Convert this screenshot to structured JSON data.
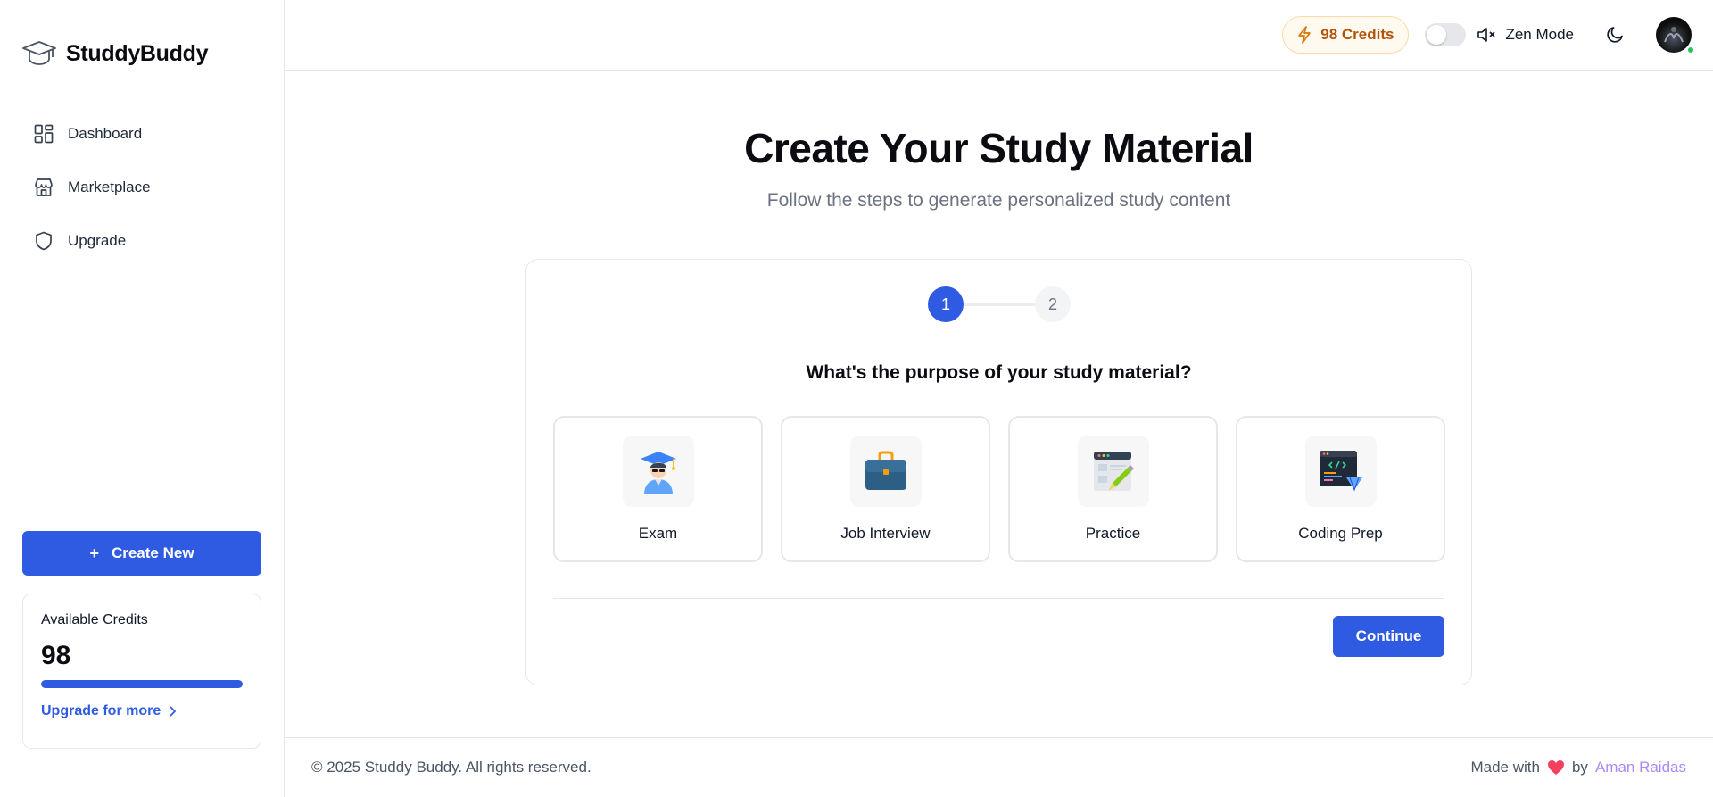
{
  "brand": {
    "name": "StuddyBuddy"
  },
  "sidebar": {
    "nav": [
      {
        "label": "Dashboard",
        "icon": "dashboard-icon"
      },
      {
        "label": "Marketplace",
        "icon": "store-icon"
      },
      {
        "label": "Upgrade",
        "icon": "shield-icon"
      }
    ],
    "create_button": {
      "label": "Create New",
      "icon": "plus-icon"
    },
    "credits_card": {
      "label": "Available Credits",
      "value": "98",
      "progress_percent": 100,
      "upgrade_label": "Upgrade for more"
    }
  },
  "topbar": {
    "credits_label": "98 Credits",
    "zen_mode_label": "Zen Mode",
    "zen_mode_enabled": false
  },
  "page": {
    "title": "Create Your Study Material",
    "subtitle": "Follow the steps to generate personalized study content"
  },
  "wizard": {
    "steps": [
      "1",
      "2"
    ],
    "current_step": 1,
    "question": "What's the purpose of your study material?",
    "options": [
      {
        "label": "Exam",
        "icon": "graduate-icon"
      },
      {
        "label": "Job Interview",
        "icon": "briefcase-icon"
      },
      {
        "label": "Practice",
        "icon": "notebook-pencil-icon"
      },
      {
        "label": "Coding Prep",
        "icon": "code-editor-icon"
      }
    ],
    "continue_label": "Continue"
  },
  "footer": {
    "copyright": "© 2025 Studdy Buddy. All rights reserved.",
    "made_with": "Made with",
    "by": "by",
    "author": "Aman Raidas"
  },
  "colors": {
    "primary": "#2f5be3",
    "credits_pill_bg": "#fffaf0",
    "credits_pill_text": "#b45309",
    "author_link": "#a78bfa",
    "heart": "#f43f5e"
  }
}
